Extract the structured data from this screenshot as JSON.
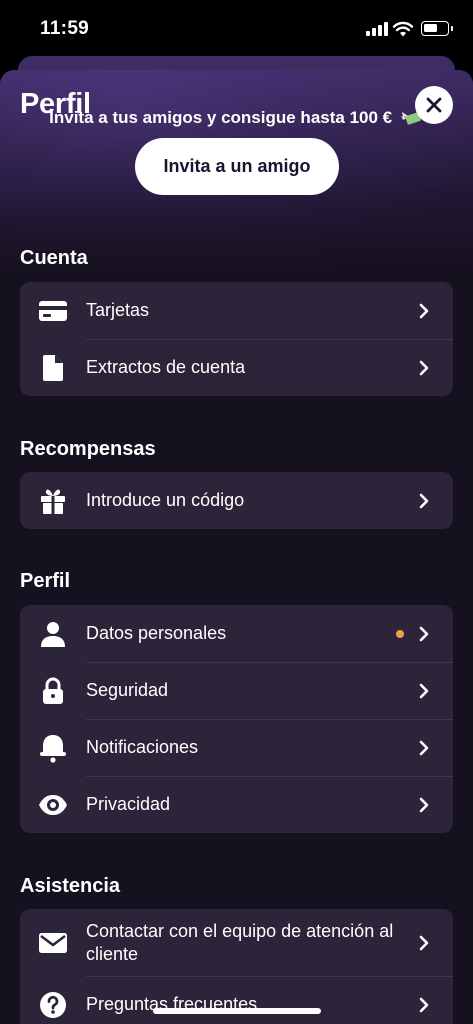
{
  "status_bar": {
    "time": "11:59"
  },
  "sheet": {
    "title": "Perfil",
    "promo_text": "Invita a tus amigos y consigue hasta 100 €",
    "invite_button": "Invita a un amigo"
  },
  "sections": {
    "cuenta": {
      "title": "Cuenta",
      "items": [
        {
          "label": "Tarjetas",
          "icon": "card-icon"
        },
        {
          "label": "Extractos de cuenta",
          "icon": "document-icon"
        }
      ]
    },
    "recompensas": {
      "title": "Recompensas",
      "items": [
        {
          "label": "Introduce un código",
          "icon": "gift-icon"
        }
      ]
    },
    "perfil": {
      "title": "Perfil",
      "items": [
        {
          "label": "Datos personales",
          "icon": "person-icon",
          "has_notification_dot": true
        },
        {
          "label": "Seguridad",
          "icon": "lock-icon"
        },
        {
          "label": "Notificaciones",
          "icon": "bell-icon"
        },
        {
          "label": "Privacidad",
          "icon": "eye-icon"
        }
      ]
    },
    "asistencia": {
      "title": "Asistencia",
      "items": [
        {
          "label": "Contactar con el equipo de atención al cliente",
          "icon": "mail-icon"
        },
        {
          "label": "Preguntas frecuentes",
          "icon": "question-icon"
        }
      ]
    }
  },
  "colors": {
    "sheet_background": "#16111f",
    "card_background": "#2c2539",
    "accent_purple": "#4b3676",
    "notification_dot": "#f0a04c"
  }
}
